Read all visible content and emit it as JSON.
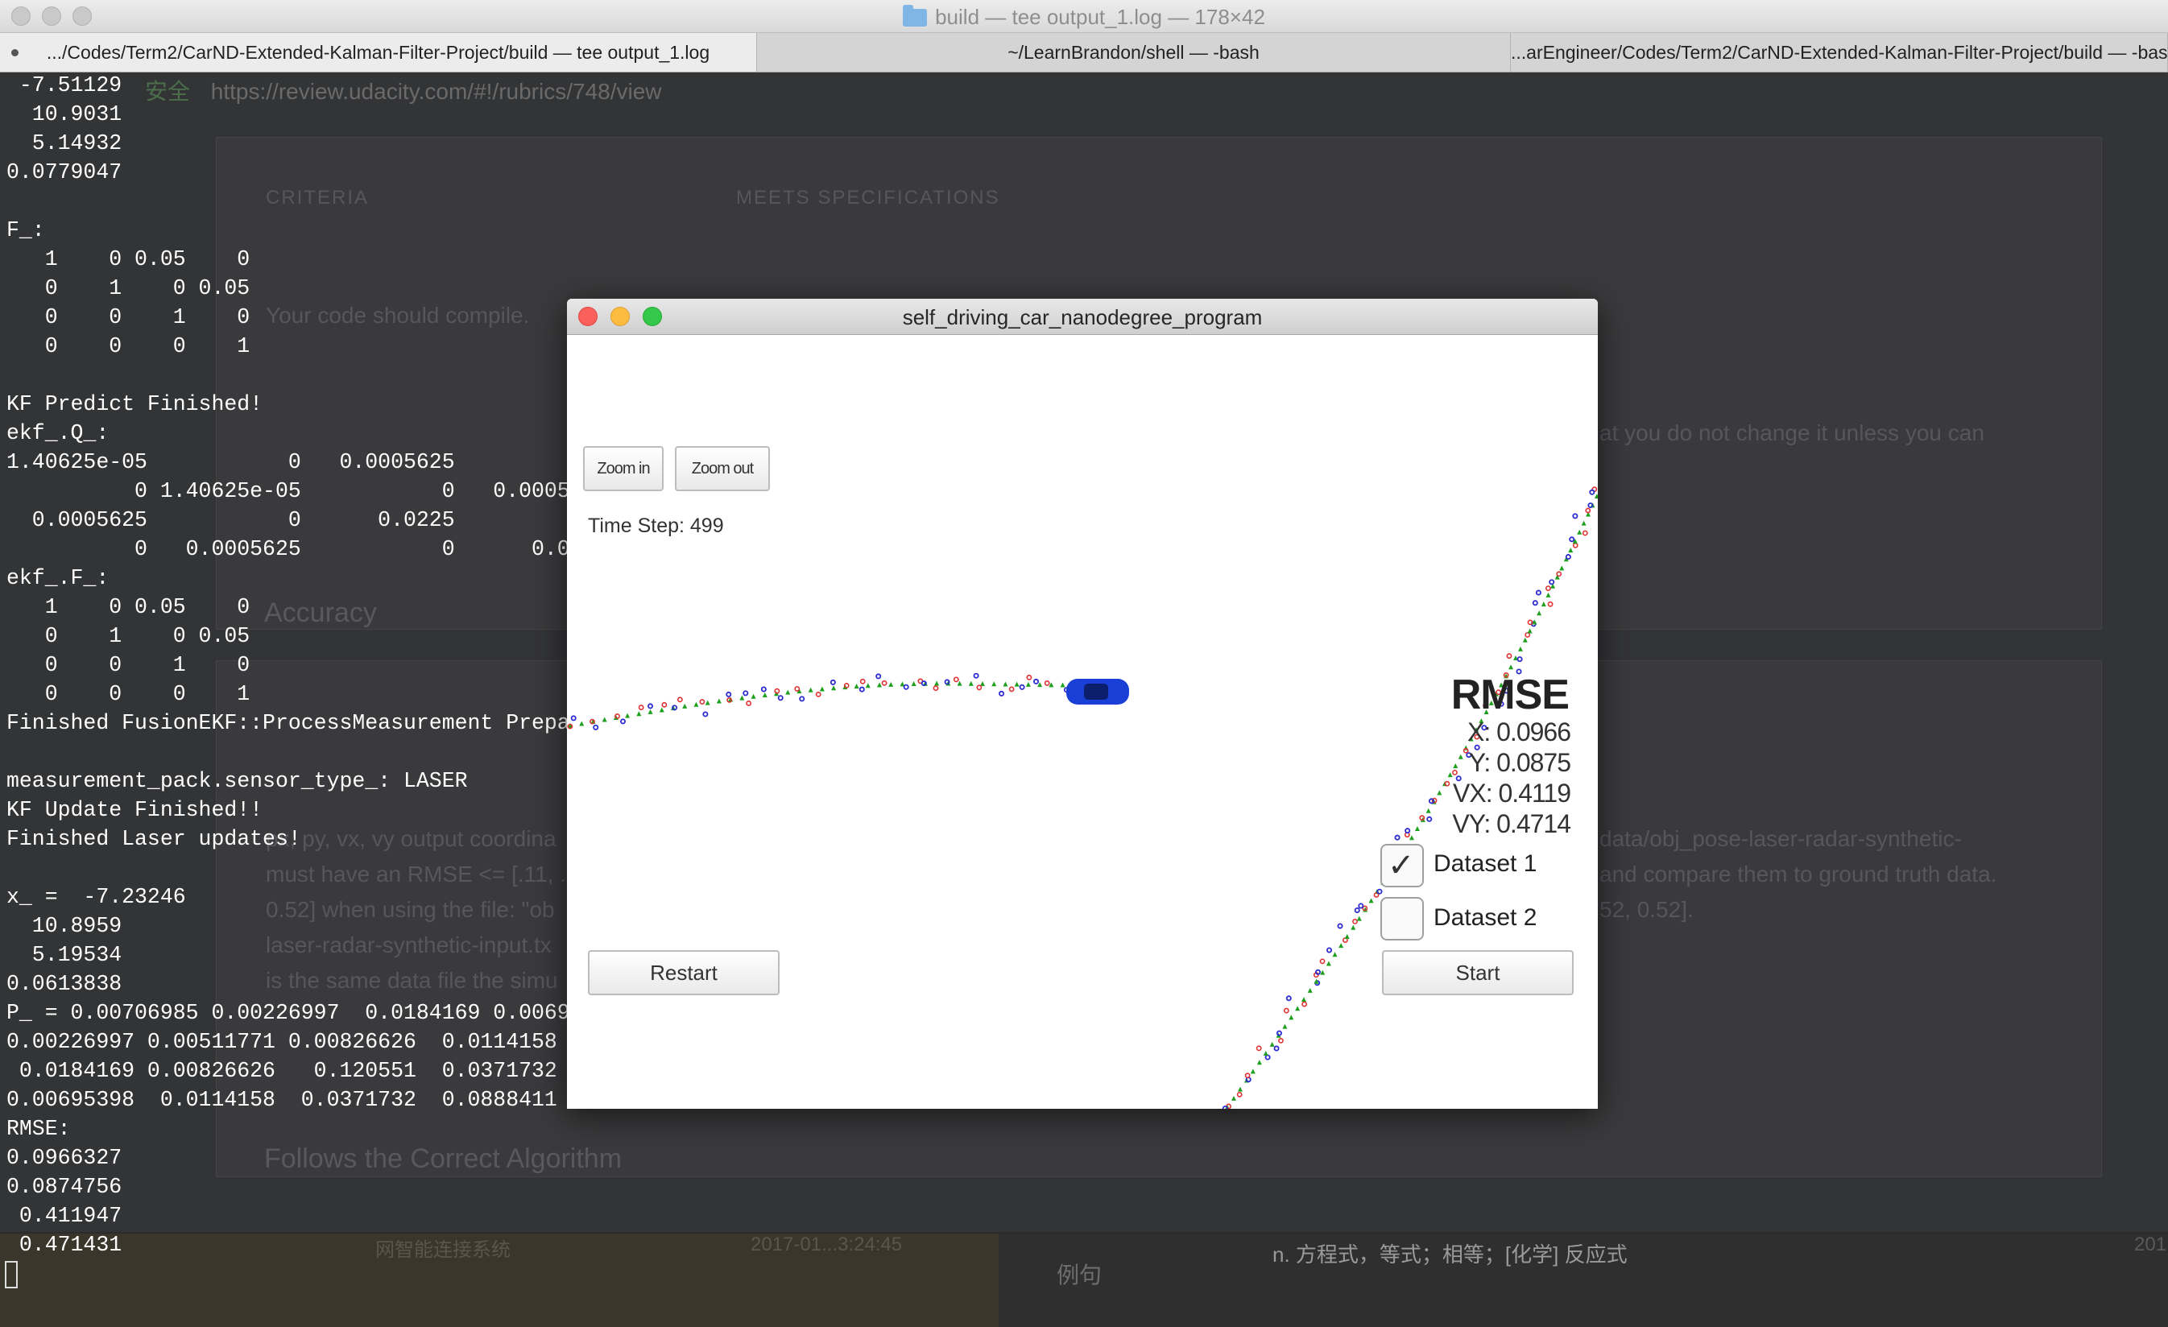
{
  "window": {
    "title": "build — tee output_1.log — 178×42"
  },
  "tabs": [
    {
      "label": ".../Codes/Term2/CarND-Extended-Kalman-Filter-Project/build — tee output_1.log",
      "active": true
    },
    {
      "label": "~/LearnBrandon/shell — -bash",
      "active": false
    },
    {
      "label": "...arEngineer/Codes/Term2/CarND-Extended-Kalman-Filter-Project/build — -bash",
      "active": false
    }
  ],
  "background_browser": {
    "secure_label": "安全",
    "url": "https://review.udacity.com/#!/rubrics/748/view",
    "criteria_header": "CRITERIA",
    "meets_header": "MEETS SPECIFICATIONS",
    "compile_text": "Your code should compile.",
    "partial_text_1": "at you do not change it unless you can",
    "accuracy_heading": "Accuracy",
    "rmse_text_left_1": "px, py, vx, vy output coordina",
    "rmse_text_left_2": "must have an RMSE <= [.11, .",
    "rmse_text_left_3": "0.52] when using the file: \"ob",
    "rmse_text_left_4": "laser-radar-synthetic-input.tx",
    "rmse_text_left_5": "is the same data file the simu",
    "rmse_text_right_1": "data/obj_pose-laser-radar-synthetic-",
    "rmse_text_right_2": "and compare them to ground truth data.",
    "rmse_text_right_3": "52, 0.52].",
    "follows_heading": "Follows the Correct Algorithm",
    "bottom_text_1": "网智能连接系统",
    "bottom_text_2": "2017-01...3:24:45",
    "bottom_text_3": "例句",
    "bottom_text_4": "n. 方程式，等式；相等；[化学] 反应式",
    "bottom_text_5": "201"
  },
  "terminal": {
    "lines": [
      " -7.51129",
      "  10.9031",
      "  5.14932",
      "0.0779047",
      "",
      "F_:",
      "   1    0 0.05    0",
      "   0    1    0 0.05",
      "   0    0    1    0",
      "   0    0    0    1",
      "",
      "KF Predict Finished!",
      "ekf_.Q_:",
      "1.40625e-05           0   0.0005625",
      "          0 1.40625e-05           0   0.0005",
      "  0.0005625           0      0.0225",
      "          0   0.0005625           0      0.0",
      "ekf_.F_:",
      "   1    0 0.05    0",
      "   0    1    0 0.05",
      "   0    0    1    0",
      "   0    0    0    1",
      "Finished FusionEKF::ProcessMeasurement Prepa",
      "",
      "measurement_pack.sensor_type_: LASER",
      "KF Update Finished!!",
      "Finished Laser updates!",
      "",
      "x_ =  -7.23246",
      "  10.8959",
      "  5.19534",
      "0.0613838",
      "P_ = 0.00706985 0.00226997  0.0184169 0.0069",
      "0.00226997 0.00511771 0.00826626  0.0114158",
      " 0.0184169 0.00826626   0.120551  0.0371732",
      "0.00695398  0.0114158  0.0371732  0.0888411",
      "RMSE:",
      "0.0966327",
      "0.0874756",
      " 0.411947",
      " 0.471431"
    ]
  },
  "simulator": {
    "title": "self_driving_car_nanodegree_program",
    "zoom_in": "Zoom in",
    "zoom_out": "Zoom out",
    "time_step": "Time Step: 499",
    "rmse_title": "RMSE",
    "rmse_x": "X: 0.0966",
    "rmse_y": "Y: 0.0875",
    "rmse_vx": "VX: 0.4119",
    "rmse_vy": "VY: 0.4714",
    "dataset1_label": "Dataset 1",
    "dataset1_checked": true,
    "dataset2_label": "Dataset 2",
    "dataset2_checked": false,
    "restart": "Restart",
    "start": "Start",
    "colors": {
      "ground_truth": "#1ea01e",
      "lidar": "#e03030",
      "radar": "#2a2ad0",
      "car": "#1a3fd6"
    }
  }
}
